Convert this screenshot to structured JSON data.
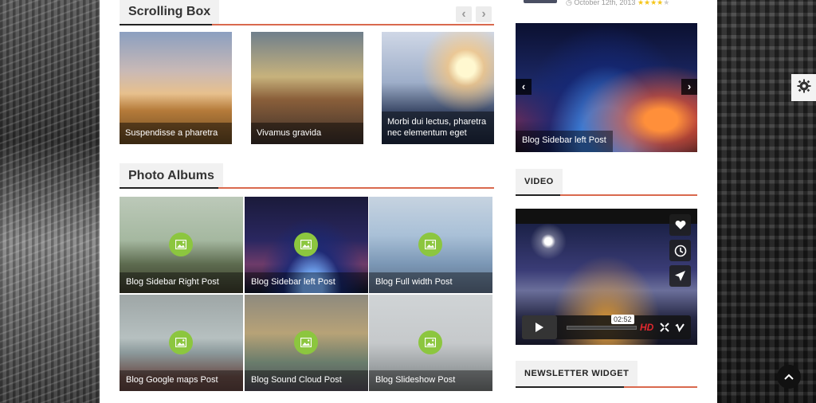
{
  "scrolling_box": {
    "title": "Scrolling Box",
    "prev_icon": "chevron-left-icon",
    "next_icon": "chevron-right-icon",
    "prev_glyph": "‹",
    "next_glyph": "›",
    "items": [
      {
        "label": "Suspendisse a pharetra"
      },
      {
        "label": "Vivamus gravida"
      },
      {
        "label": "Morbi dui lectus, pharetra nec elementum eget"
      }
    ]
  },
  "photo_albums": {
    "title": "Photo Albums",
    "items": [
      {
        "label": "Blog Sidebar Right Post"
      },
      {
        "label": "Blog Sidebar left Post"
      },
      {
        "label": "Blog Full width Post"
      },
      {
        "label": "Blog Google maps Post"
      },
      {
        "label": "Blog Sound Cloud Post"
      },
      {
        "label": "Blog Slideshow Post"
      }
    ],
    "badge_icon": "image-icon",
    "badge_color": "#8cc63f"
  },
  "sidebar": {
    "top_meta": {
      "date": "October 12th, 2013",
      "stars": "★★★★",
      "empty_star": "★"
    },
    "slider": {
      "label": "Blog Sidebar left Post",
      "prev_glyph": "‹",
      "next_glyph": "›"
    },
    "video_widget": {
      "title": "VIDEO",
      "time": "02:52",
      "hd_label": "HD"
    },
    "newsletter_widget": {
      "title": "NEWSLETTER WIDGET"
    }
  },
  "colors": {
    "accent_red": "#d9694e",
    "accent_green": "#8cc63f",
    "dark": "#222222"
  }
}
